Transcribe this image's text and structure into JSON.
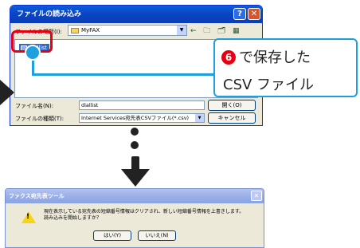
{
  "open_dialog": {
    "title": "ファイルの読み込み",
    "lookin_label": "ファイルの場所(I):",
    "lookin_value": "MyFAX",
    "nav_icons": "← 🗀 🗂 ▦",
    "file_item": "diallist",
    "filename_label": "ファイル名(N):",
    "filename_value": "diallist",
    "filetype_label": "ファイルの種類(T):",
    "filetype_value": "Internet Services宛先表CSVファイル(*.csv)",
    "open_button": "開く(O)",
    "cancel_button": "キャンセル"
  },
  "callout": {
    "step_number": "6",
    "line1": "で保存した",
    "line2": "CSV ファイル"
  },
  "confirm_dialog": {
    "title": "ファクス宛先表ツール",
    "message_line1": "現在表示している宛先表の短縮番号情報はクリアされ、新しい短縮番号情報を上書きします。",
    "message_line2": "読み込みを開始しますか？",
    "yes_button": "はい(Y)",
    "no_button": "いいえ(N)"
  },
  "colors": {
    "callout_border": "#1d9fe0",
    "highlight_red": "#e60012",
    "step_badge": "#e60012"
  }
}
